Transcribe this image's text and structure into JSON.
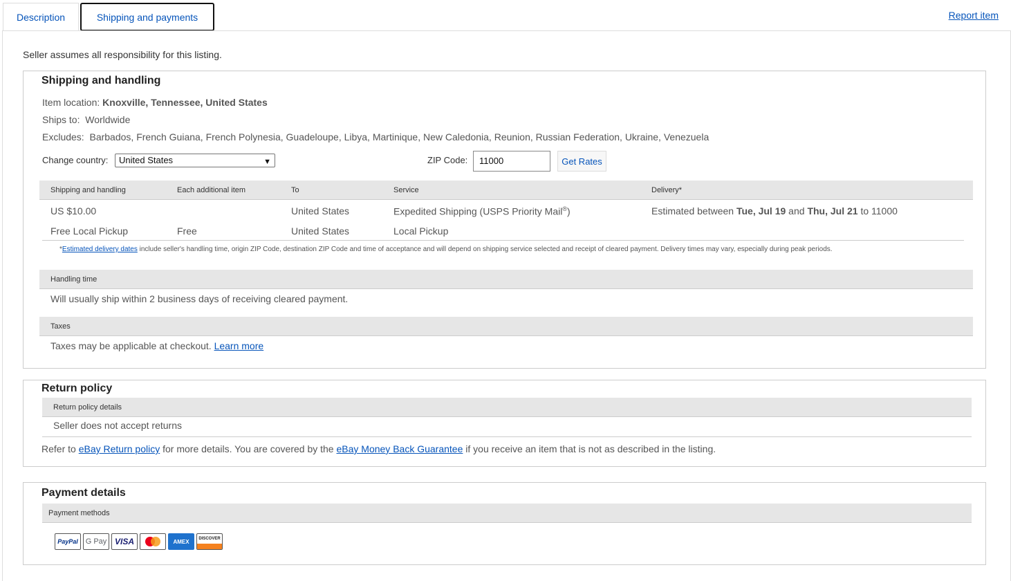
{
  "tabs": {
    "description": "Description",
    "shipping": "Shipping and payments"
  },
  "report_item": "Report item",
  "responsibility": "Seller assumes all responsibility for this listing.",
  "shipping": {
    "title": "Shipping and handling",
    "item_location_label": "Item location:",
    "item_location": "Knoxville, Tennessee, United States",
    "ships_to_label": "Ships to:",
    "ships_to": "Worldwide",
    "excludes_label": "Excludes:",
    "excludes": "Barbados, French Guiana, French Polynesia, Guadeloupe, Libya, Martinique, New Caledonia, Reunion, Russian Federation, Ukraine, Venezuela",
    "change_country_label": "Change country:",
    "country": "United States",
    "zip_label": "ZIP Code:",
    "zip_value": "11000",
    "get_rates": "Get Rates",
    "headers": [
      "Shipping and handling",
      "Each additional item",
      "To",
      "Service",
      "Delivery*"
    ],
    "rows": [
      {
        "cost": "US $10.00",
        "additional": "",
        "to": "United States",
        "service": "Expedited Shipping (USPS Priority Mail",
        "service_sup": "®",
        "service_end": ")",
        "delivery_pre": "Estimated between ",
        "delivery_d1": "Tue, Jul 19",
        "delivery_mid": " and ",
        "delivery_d2": "Thu, Jul 21",
        "delivery_post": " to 11000"
      },
      {
        "cost": "Free Local Pickup",
        "additional": "Free",
        "to": "United States",
        "service": "Local Pickup"
      }
    ],
    "note_star": "*",
    "note_link": "Estimated delivery dates",
    "note_text": " include seller's handling time, origin ZIP Code, destination ZIP Code and time of acceptance and will depend on shipping service selected and receipt of cleared payment. Delivery times may vary, especially during peak periods.",
    "handling_header": "Handling time",
    "handling_text": "Will usually ship within 2 business days of receiving cleared payment.",
    "taxes_header": "Taxes",
    "taxes_text": "Taxes may be applicable at checkout. ",
    "taxes_link": "Learn more"
  },
  "returns": {
    "title": "Return policy",
    "header": "Return policy details",
    "text": "Seller does not accept returns",
    "refer_pre": "Refer to ",
    "refer_link1": "eBay Return policy",
    "refer_mid": " for more details. You are covered by the ",
    "refer_link2": "eBay Money Back Guarantee",
    "refer_post": " if you receive an item that is not as described in the listing."
  },
  "payment": {
    "title": "Payment details",
    "header": "Payment methods",
    "methods": [
      "PayPal",
      "G Pay",
      "VISA",
      "Mastercard",
      "AMEX",
      "DISCOVER"
    ]
  }
}
